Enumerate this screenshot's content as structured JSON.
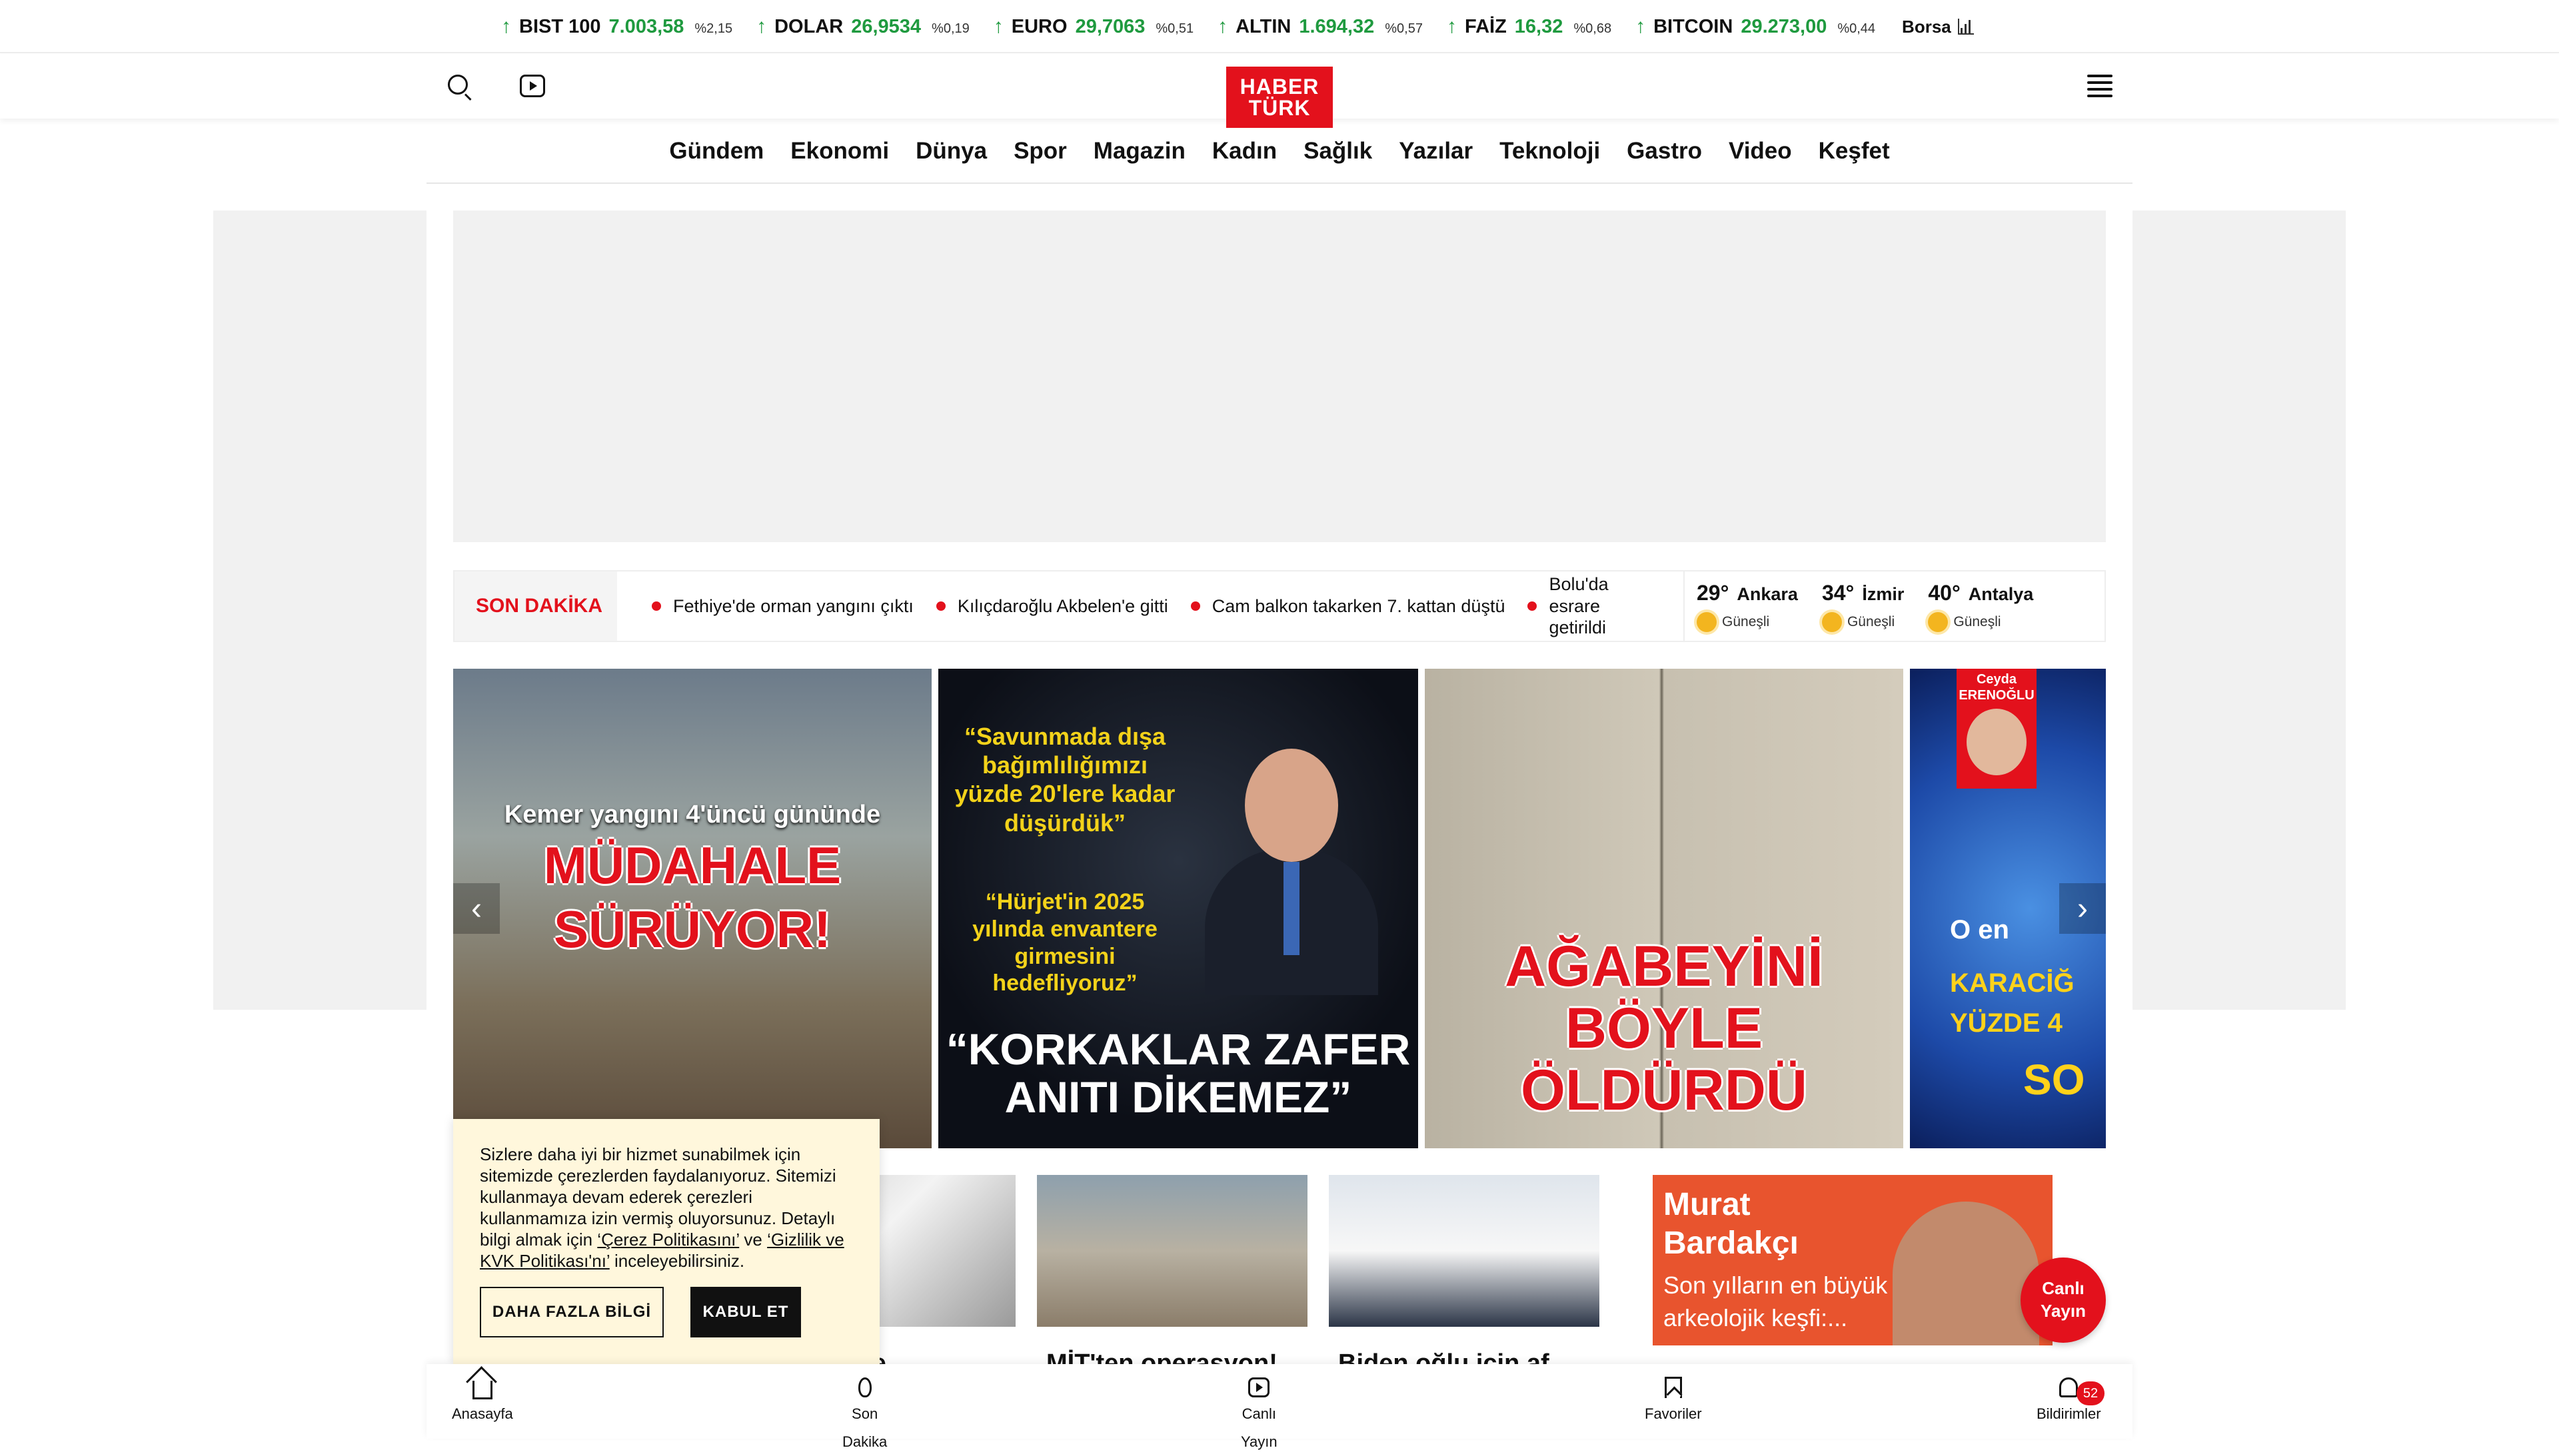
{
  "ticker": {
    "items": [
      {
        "name": "BIST 100",
        "value": "7.003,58",
        "change": "%2,15"
      },
      {
        "name": "DOLAR",
        "value": "26,9534",
        "change": "%0,19"
      },
      {
        "name": "EURO",
        "value": "29,7063",
        "change": "%0,51"
      },
      {
        "name": "ALTIN",
        "value": "1.694,32",
        "change": "%0,57"
      },
      {
        "name": "FAİZ",
        "value": "16,32",
        "change": "%0,68"
      },
      {
        "name": "BITCOIN",
        "value": "29.273,00",
        "change": "%0,44"
      }
    ],
    "borsa_label": "Borsa",
    "arrow": "↑",
    "up_color": "#1f9a3f"
  },
  "header": {
    "logo_line1": "HABER",
    "logo_line2": "TÜRK",
    "brand_color": "#e3111c"
  },
  "nav": {
    "items": [
      "Gündem",
      "Ekonomi",
      "Dünya",
      "Spor",
      "Magazin",
      "Kadın",
      "Sağlık",
      "Yazılar",
      "Teknoloji",
      "Gastro",
      "Video",
      "Keşfet"
    ]
  },
  "breaking": {
    "label": "SON DAKİKA",
    "items": [
      "Fethiye'de orman yangını çıktı",
      "Kılıçdaroğlu Akbelen'e gitti",
      "Cam balkon takarken 7. kattan düştü",
      "Bolu'da esrarengiz ölüm: Cesedi getirildi"
    ],
    "visible_partial": "Bolu'da esrare getirildi"
  },
  "weather": [
    {
      "temp": "29°",
      "city": "Ankara",
      "condition": "Güneşli"
    },
    {
      "temp": "34°",
      "city": "İzmir",
      "condition": "Güneşli"
    },
    {
      "temp": "40°",
      "city": "Antalya",
      "condition": "Güneşli"
    }
  ],
  "slider": {
    "slide1": {
      "sub": "Kemer yangını 4'üncü gününde",
      "big1": "MÜDAHALE",
      "big2": "SÜRÜYOR!"
    },
    "slide2": {
      "quote1": "“Savunmada dışa bağımlılığımızı yüzde 20'lere kadar düşürdük”",
      "quote2": "“Hürjet'in 2025 yılında envantere girmesini hedefliyoruz”",
      "headline": "“KORKAKLAR ZAFER ANITI DİKEMEZ”"
    },
    "slide3": {
      "headline1": "AĞABEYİNİ",
      "headline2": "BÖYLE",
      "headline3": "ÖLDÜRDÜ"
    },
    "slide4": {
      "author1": "Ceyda",
      "author2": "ERENOĞLU",
      "t1": "O en",
      "t2": "KARACİĞ",
      "t3": "YÜZDE 4",
      "t4": "SO"
    },
    "prev": "‹",
    "next": "›"
  },
  "cards": [
    {
      "title": "polise"
    },
    {
      "title": "MİT'ten operasyon!"
    },
    {
      "title": "Biden oğlu için af"
    }
  ],
  "column": {
    "author": "Murat Bardakçı",
    "teaser": "Son yılların en büyük arkeolojik keşfi:..."
  },
  "live": {
    "line1": "Canlı",
    "line2": "Yayın"
  },
  "cookie": {
    "text1": "Sizlere daha iyi bir hizmet sunabilmek için sitemizde çerezlerden faydalanıyoruz. Sitemizi kullanmaya devam ederek çerezleri kullanmamıza izin vermiş oluyorsunuz. Detaylı bilgi almak için ",
    "link1": "‘Çerez Politikasını’",
    "text2": " ve ",
    "link2": "‘Gizlilik ve KVK Politikası'nı’",
    "text3": " inceleyebilirsiniz.",
    "more_label": "DAHA FAZLA BİLGİ",
    "accept_label": "KABUL ET"
  },
  "tabbar": {
    "home": "Anasayfa",
    "flash_1": "Son",
    "flash_2": "Dakika",
    "live_1": "Canlı",
    "live_2": "Yayın",
    "favorites": "Favoriler",
    "notifications": "Bildirimler",
    "notif_count": "52"
  }
}
